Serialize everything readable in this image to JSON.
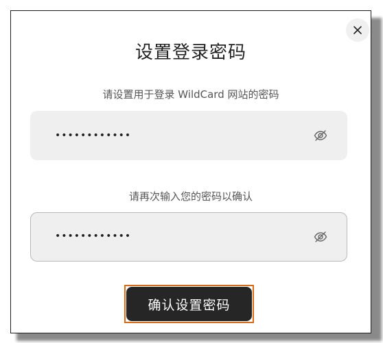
{
  "dialog": {
    "title": "设置登录密码",
    "close_icon": "close-icon"
  },
  "password_field": {
    "label": "请设置用于登录 WildCard 网站的密码",
    "value": "••••••••••••",
    "toggle_icon": "eye-slash-icon"
  },
  "confirm_field": {
    "label": "请再次输入您的密码以确认",
    "value": "••••••••••••",
    "toggle_icon": "eye-slash-icon"
  },
  "submit": {
    "label": "确认设置密码",
    "highlight_color": "#e06a14",
    "background_color": "#262626"
  }
}
